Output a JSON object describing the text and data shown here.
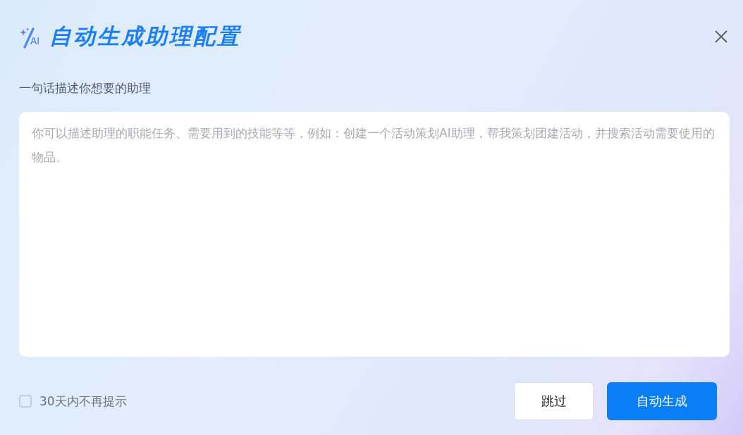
{
  "dialog": {
    "logo_text": "AI",
    "title": "自动生成助理配置"
  },
  "prompt": {
    "label": "一句话描述你想要的助理",
    "placeholder": "你可以描述助理的职能任务、需要用到的技能等等，例如：创建一个活动策划AI助理，帮我策划团建活动，并搜索活动需要使用的物品。"
  },
  "dont_remind": {
    "label": "30天内不再提示",
    "checked": false
  },
  "buttons": [
    {
      "label": "跳过",
      "kind": "secondary"
    },
    {
      "label": "自动生成",
      "kind": "primary"
    }
  ]
}
